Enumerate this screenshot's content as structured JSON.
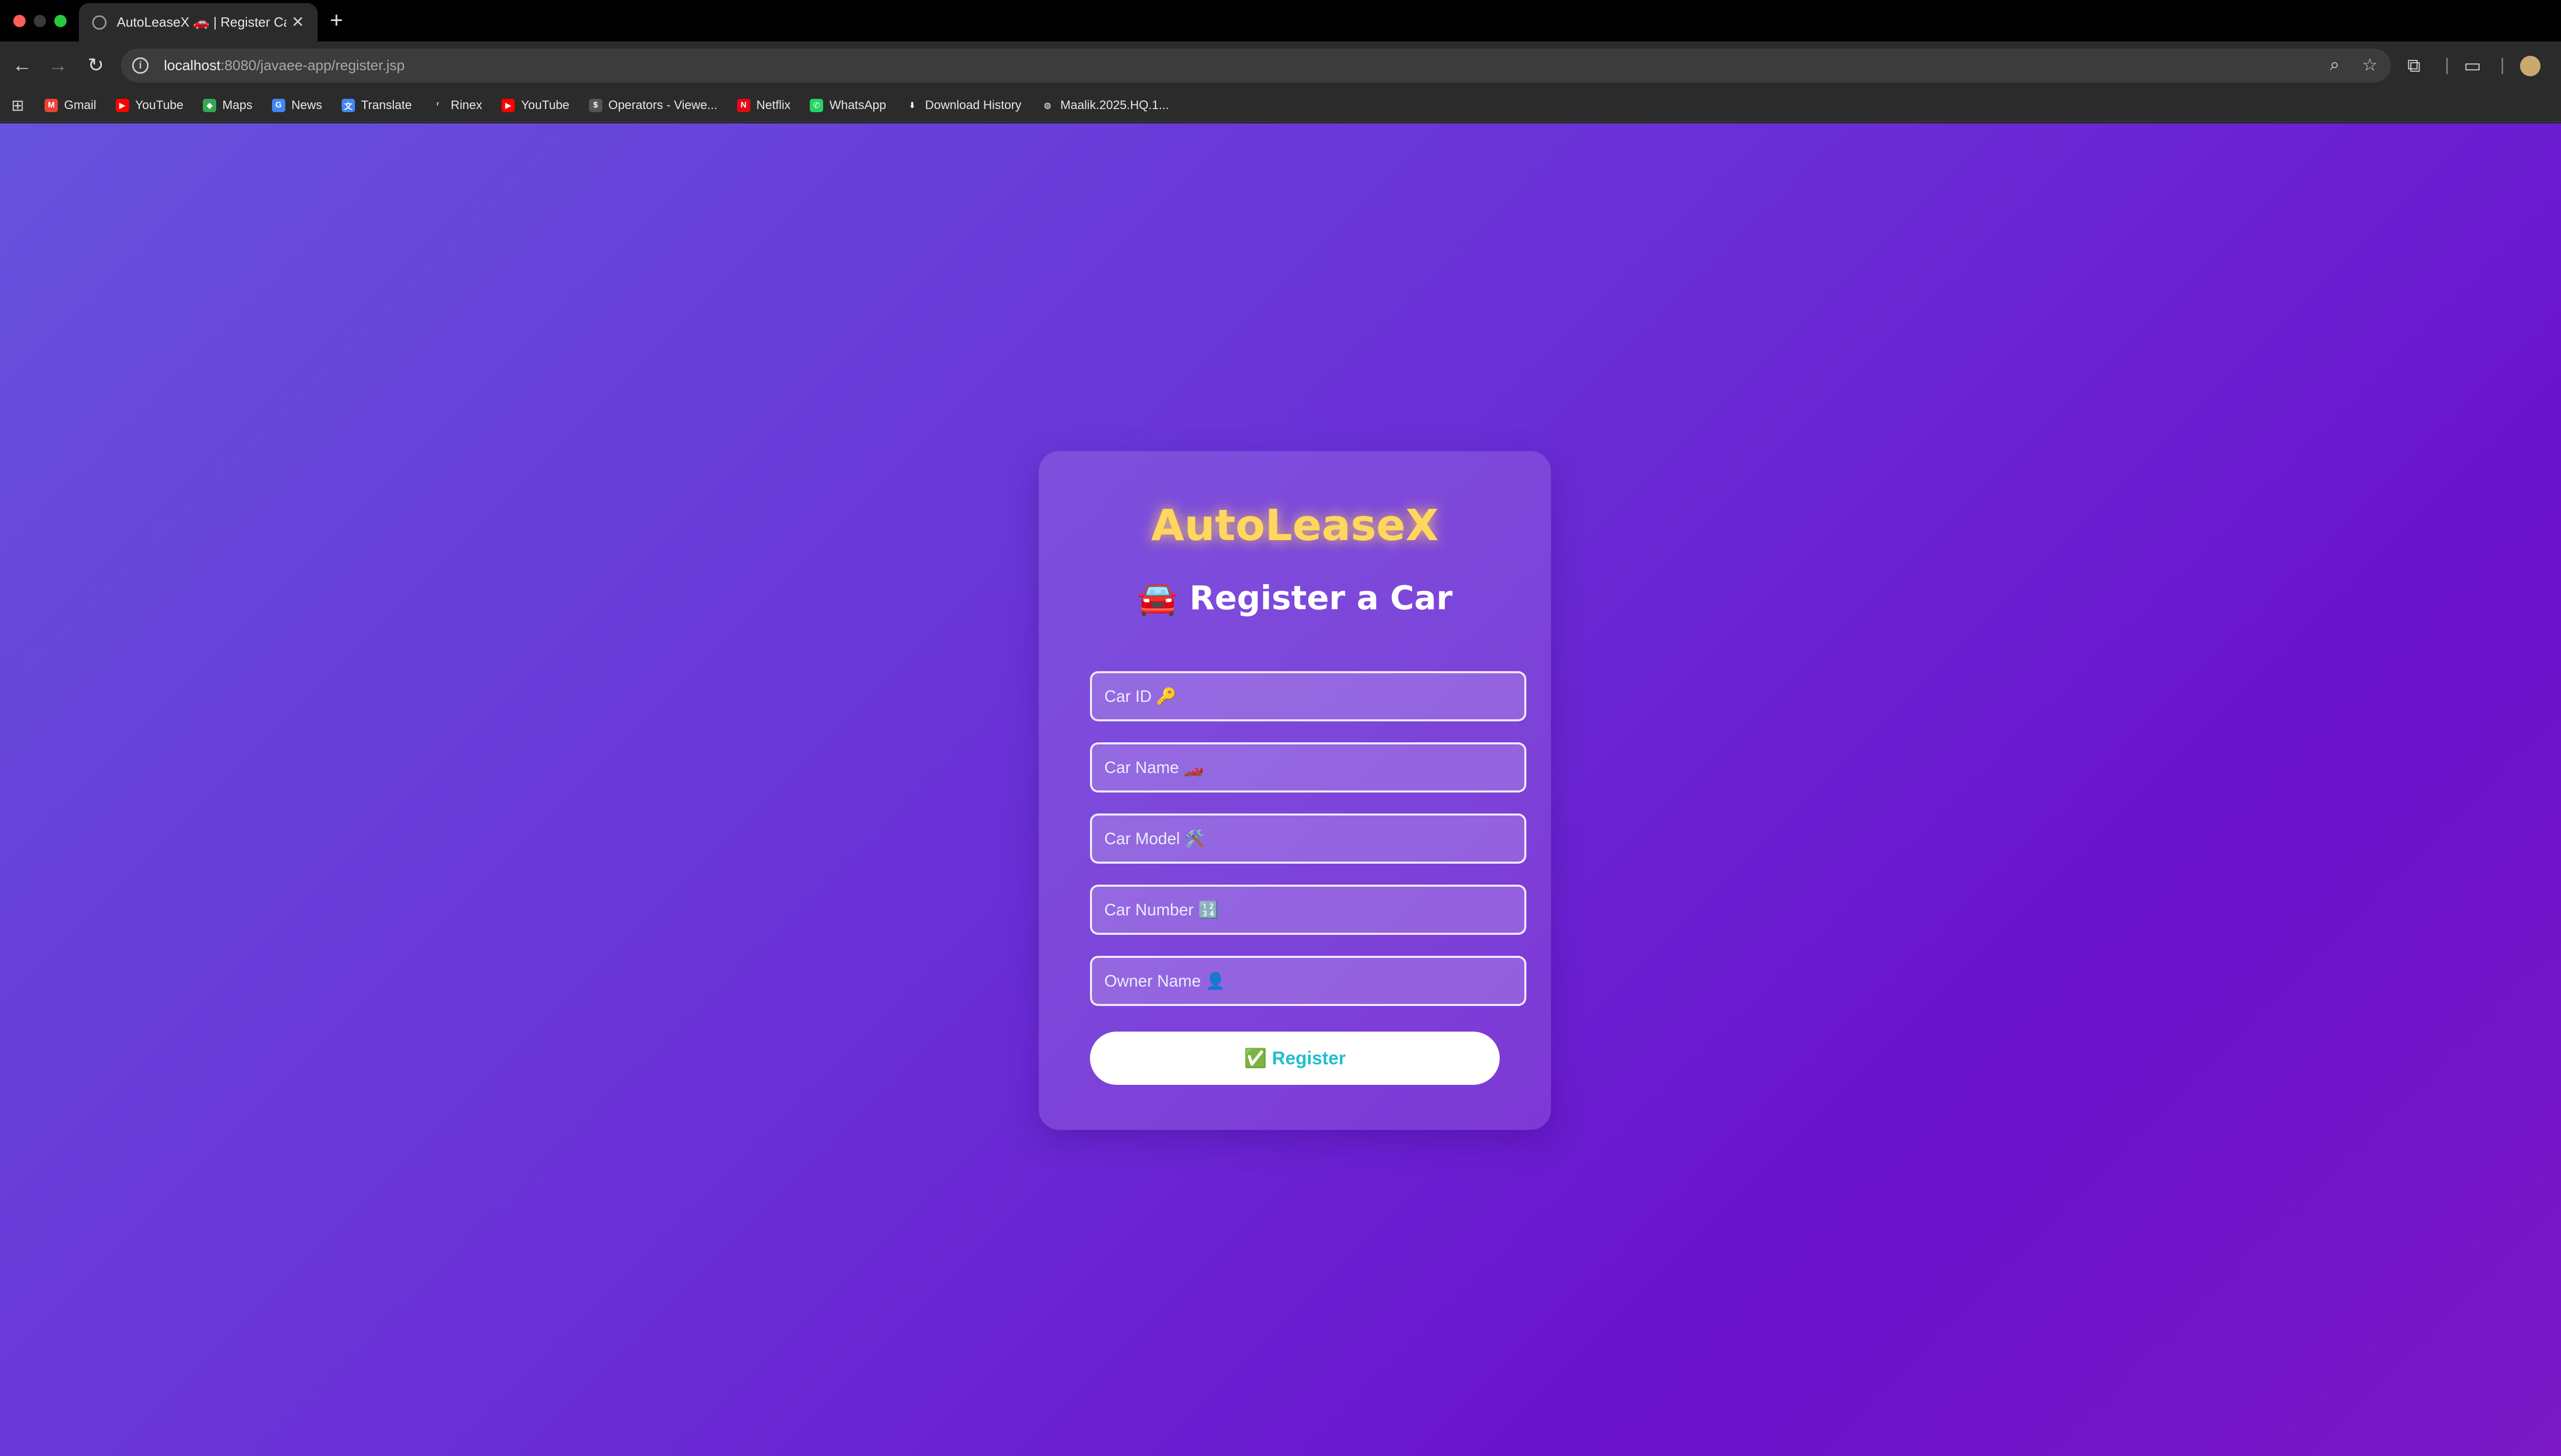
{
  "browser": {
    "tab_title": "AutoLeaseX 🚗 | Register Car",
    "new_tab": "+",
    "url_host": "localhost",
    "url_path": ":8080/javaee-app/register.jsp",
    "bookmarks": [
      {
        "label": "Gmail",
        "icon": "gmail-icon",
        "color": "#ea4335",
        "glyph": "M"
      },
      {
        "label": "YouTube",
        "icon": "youtube-icon",
        "color": "#ff0000",
        "glyph": "▶"
      },
      {
        "label": "Maps",
        "icon": "maps-icon",
        "color": "#34a853",
        "glyph": "◆"
      },
      {
        "label": "News",
        "icon": "news-icon",
        "color": "#4285f4",
        "glyph": "G"
      },
      {
        "label": "Translate",
        "icon": "translate-icon",
        "color": "#4285f4",
        "glyph": "文"
      },
      {
        "label": "Rinex",
        "icon": "rinex-icon",
        "color": "#2b2b2b",
        "glyph": "ʳ"
      },
      {
        "label": "YouTube",
        "icon": "youtube-icon",
        "color": "#ff0000",
        "glyph": "▶"
      },
      {
        "label": "Operators - Viewe...",
        "icon": "operators-icon",
        "color": "#555555",
        "glyph": "$"
      },
      {
        "label": "Netflix",
        "icon": "netflix-icon",
        "color": "#e50914",
        "glyph": "N"
      },
      {
        "label": "WhatsApp",
        "icon": "whatsapp-icon",
        "color": "#25d366",
        "glyph": "✆"
      },
      {
        "label": "Download History",
        "icon": "download-icon",
        "color": "#2b2b2b",
        "glyph": "⬇"
      },
      {
        "label": "Maalik.2025.HQ.1...",
        "icon": "globe-icon",
        "color": "#2b2b2b",
        "glyph": "◍"
      }
    ]
  },
  "app": {
    "brand": "AutoLeaseX",
    "heading": "🚘 Register a Car",
    "fields": [
      {
        "placeholder": "Car ID 🔑"
      },
      {
        "placeholder": "Car Name 🏎️"
      },
      {
        "placeholder": "Car Model 🛠️"
      },
      {
        "placeholder": "Car Number 🔢"
      },
      {
        "placeholder": "Owner Name 👤"
      }
    ],
    "register_label": "✅ Register"
  },
  "colors": {
    "brand": "#ffd75e",
    "button_text": "#1fbfcf",
    "gradient_start": "#6652dc",
    "gradient_end": "#7a18c4"
  }
}
